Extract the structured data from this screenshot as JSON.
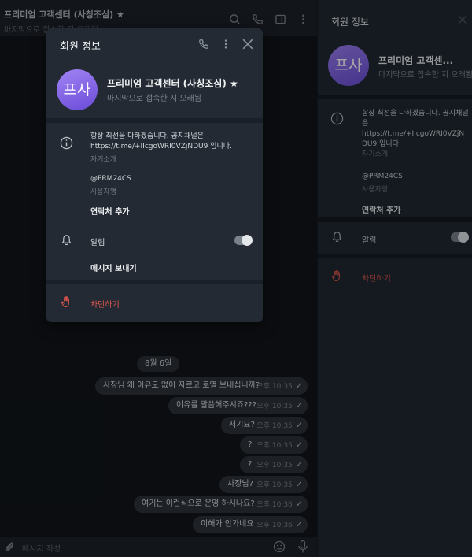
{
  "chat": {
    "title": "프리미엄 고객센터 (사칭조심) ★",
    "status": "마지막으로 접속한 지 오래됨",
    "date_label": "8월 6일",
    "messages": [
      {
        "text": "사장님 왜 이유도 없이 자르고 로열 보내십니까?",
        "time": "오후 10:35"
      },
      {
        "text": "이유를 말씀해주시죠???",
        "time": "오후 10:35"
      },
      {
        "text": "저기요?",
        "time": "오후 10:35"
      },
      {
        "text": "?",
        "time": "오후 10:35"
      },
      {
        "text": "?",
        "time": "오후 10:35"
      },
      {
        "text": "사장님?",
        "time": "오후 10:35"
      },
      {
        "text": "여기는 이런식으로 운영 하시나요?",
        "time": "오후 10:36"
      },
      {
        "text": "이해가 안가네요",
        "time": "오후 10:36"
      }
    ],
    "composer_placeholder": "메시지 작성..."
  },
  "side_panel": {
    "title": "회원 정보",
    "avatar_initials": "프사",
    "name": "프리미엄 고객센...",
    "status": "마지막으로 접속한 지 오래됨",
    "description_line1": "항상 최선을 다하겠습니다. 공지채널은",
    "description_line2": "https://t.me/+IIcgoWRI0VZjNDU9 입니다.",
    "description_label": "자기소개",
    "username": "@PRM24CS",
    "username_label": "사용자명",
    "add_contact": "연락처 추가",
    "notifications": "알림",
    "notifications_on": true,
    "block": "차단하기"
  },
  "modal": {
    "title": "회원 정보",
    "avatar_initials": "프사",
    "name": "프리미엄 고객센터 (사칭조심) ★",
    "status": "마지막으로 접속한 지 오래됨",
    "description_line1": "항상 최선을 다하겠습니다. 공지채널은",
    "description_line2": "https://t.me/+IIcgoWRI0VZjNDU9 입니다.",
    "description_label": "자기소개",
    "username": "@PRM24CS",
    "username_label": "사용자명",
    "add_contact": "연락처 추가",
    "notifications": "알림",
    "notifications_on": true,
    "send_message": "메시지 보내기",
    "block": "차단하기"
  },
  "colors": {
    "accent_avatar": "#7c5fe6",
    "danger": "#e0564c",
    "background": "#0e1621"
  }
}
